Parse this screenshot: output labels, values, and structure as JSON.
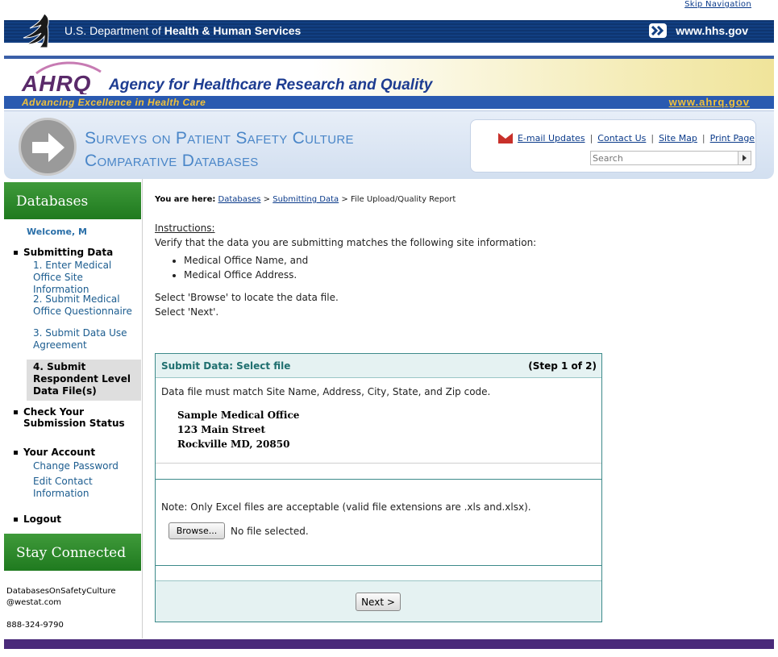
{
  "skip_nav": "Skip Navigation",
  "hhs": {
    "dept_prefix": "U.S. Department of ",
    "dept_bold": "Health & Human Services",
    "url": "www.hhs.gov",
    "logo_icon": "hhs-eagle-icon",
    "arrow_icon": "double-chevron-right-icon"
  },
  "ahrq": {
    "logo_text": "AHRQ",
    "name": "Agency for Healthcare Research and Quality",
    "tagline": "Advancing Excellence in Health Care",
    "url": "www.ahrq.gov"
  },
  "banner": {
    "title_line1": "Surveys on Patient Safety Culture",
    "title_line2": "Comparative Databases",
    "arrow_icon": "arrow-right-circle-icon"
  },
  "utility": {
    "email_updates": "E-mail Updates",
    "contact_us": "Contact Us",
    "site_map": "Site Map",
    "print_page": "Print Page",
    "sep": "|",
    "search_placeholder": "Search",
    "mail_icon": "envelope-icon"
  },
  "sidebar": {
    "databases_heading": "Databases",
    "welcome": "Welcome, M",
    "submitting_data": "Submitting Data",
    "items": [
      {
        "label": "1. Enter Medical Office Site Information"
      },
      {
        "label": "2. Submit Medical Office Questionnaire"
      },
      {
        "label": "3. Submit Data Use Agreement"
      },
      {
        "label": "4. Submit Respondent Level Data File(s)",
        "active": true
      }
    ],
    "check_status": "Check Your Submission Status",
    "your_account": "Your Account",
    "change_password": "Change Password",
    "edit_contact": "Edit Contact Information",
    "logout": "Logout",
    "stay_connected": "Stay Connected",
    "contact_email_line1": "DatabasesOnSafetyCulture",
    "contact_email_line2": "@westat.com",
    "contact_phone": "888-324-9790"
  },
  "breadcrumb": {
    "prefix": "You are here:",
    "databases": "Databases",
    "sep": ">",
    "submitting_data": "Submitting Data",
    "current": "File Upload/Quality Report"
  },
  "instructions": {
    "title": "Instructions:",
    "intro": "Verify that the data you are submitting matches the following site information:",
    "bullets": [
      "Medical Office Name, and",
      "Medical Office Address."
    ],
    "step1": "Select 'Browse' to locate the data file.",
    "step2": "Select 'Next'."
  },
  "panel": {
    "title": "Submit Data: Select file",
    "step": "(Step 1 of 2)",
    "match_note": "Data file must match Site Name, Address, City, State, and Zip code.",
    "site_name": "Sample Medical Office",
    "site_street": "123 Main Street",
    "site_city": "Rockville MD, 20850",
    "upload_note": "Note: Only Excel files are acceptable (valid file extensions are .xls and.xlsx).",
    "browse_label": "Browse...",
    "no_file": "No file selected.",
    "next_label": "Next >"
  },
  "colors": {
    "hhs_blue": "#123f82",
    "ahrq_blue": "#1d3c91",
    "gold": "#f2c23a",
    "sidebar_green": "#2a8a2a",
    "panel_teal": "#3d8a8a",
    "footer_purple": "#4a2a7a"
  }
}
